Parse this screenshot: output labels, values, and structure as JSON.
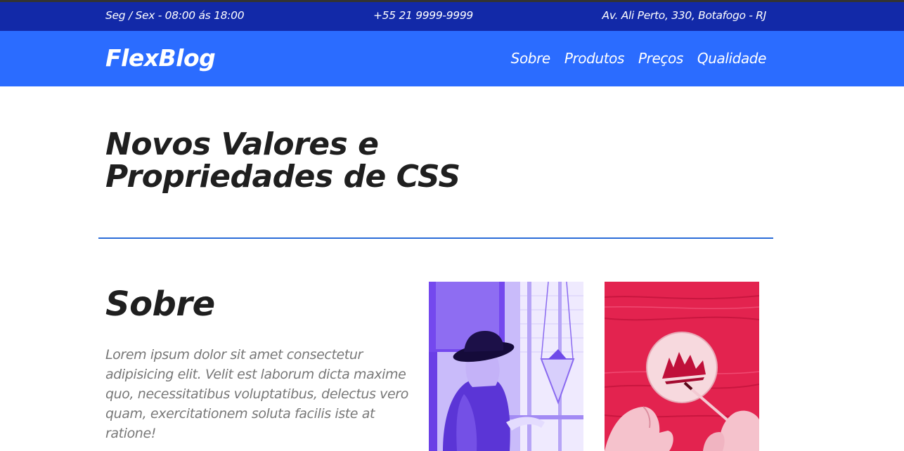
{
  "topbar": {
    "hours": "Seg / Sex - 08:00 ás 18:00",
    "phone": "+55 21 9999-9999",
    "address": "Av. Ali Perto, 330, Botafogo - RJ"
  },
  "navbar": {
    "logo": "FlexBlog",
    "menu": [
      {
        "label": "Sobre"
      },
      {
        "label": "Produtos"
      },
      {
        "label": "Preços"
      },
      {
        "label": "Qualidade"
      }
    ]
  },
  "hero": {
    "title_line1": "Novos Valores e",
    "title_line2": "Propriedades de CSS"
  },
  "about": {
    "title": "Sobre",
    "text": "Lorem ipsum dolor sit amet consectetur adipisicing elit. Velit est laborum dicta maxime quo, necessitatibus voluptatibus, delectus vero quam, exercitationem soluta facilis iste at ratione!"
  },
  "colors": {
    "topbar": "#1229a8",
    "navbar": "#2b6cff",
    "divider": "#2b6cd8",
    "photo_purple": "#7a55f0",
    "photo_red": "#e2224e"
  }
}
